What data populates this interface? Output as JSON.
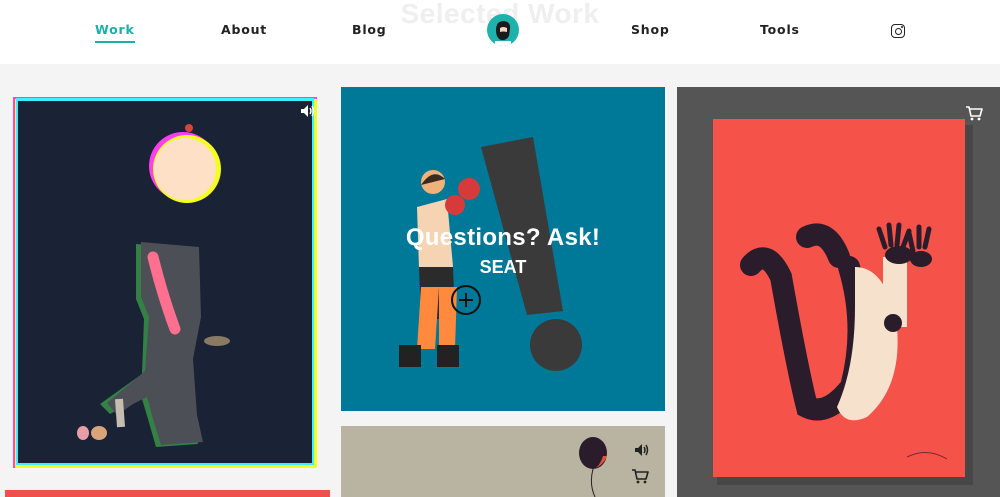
{
  "header": {
    "watermark": "Selected Work",
    "nav": {
      "work": "Work",
      "about": "About",
      "blog": "Blog",
      "shop": "Shop",
      "tools": "Tools"
    },
    "active_item": "Work"
  },
  "icons": {
    "logo": "avatar-logo-icon",
    "social": "instagram-icon",
    "audio": "speaker-icon",
    "cart": "shopping-cart-icon",
    "expand": "plus-circle-icon"
  },
  "featured": {
    "title": "Questions? Ask!",
    "subtitle": "SEAT"
  },
  "colors": {
    "accent": "#1ab0a9",
    "tile_walker_bg": "#1a2236",
    "tile_boxer_bg": "#007898",
    "tile_poster_bg": "#555555",
    "poster_red": "#f5524a",
    "tile_balloon_bg": "#b8b4a1",
    "tile_bottom_red": "#f0504a"
  }
}
